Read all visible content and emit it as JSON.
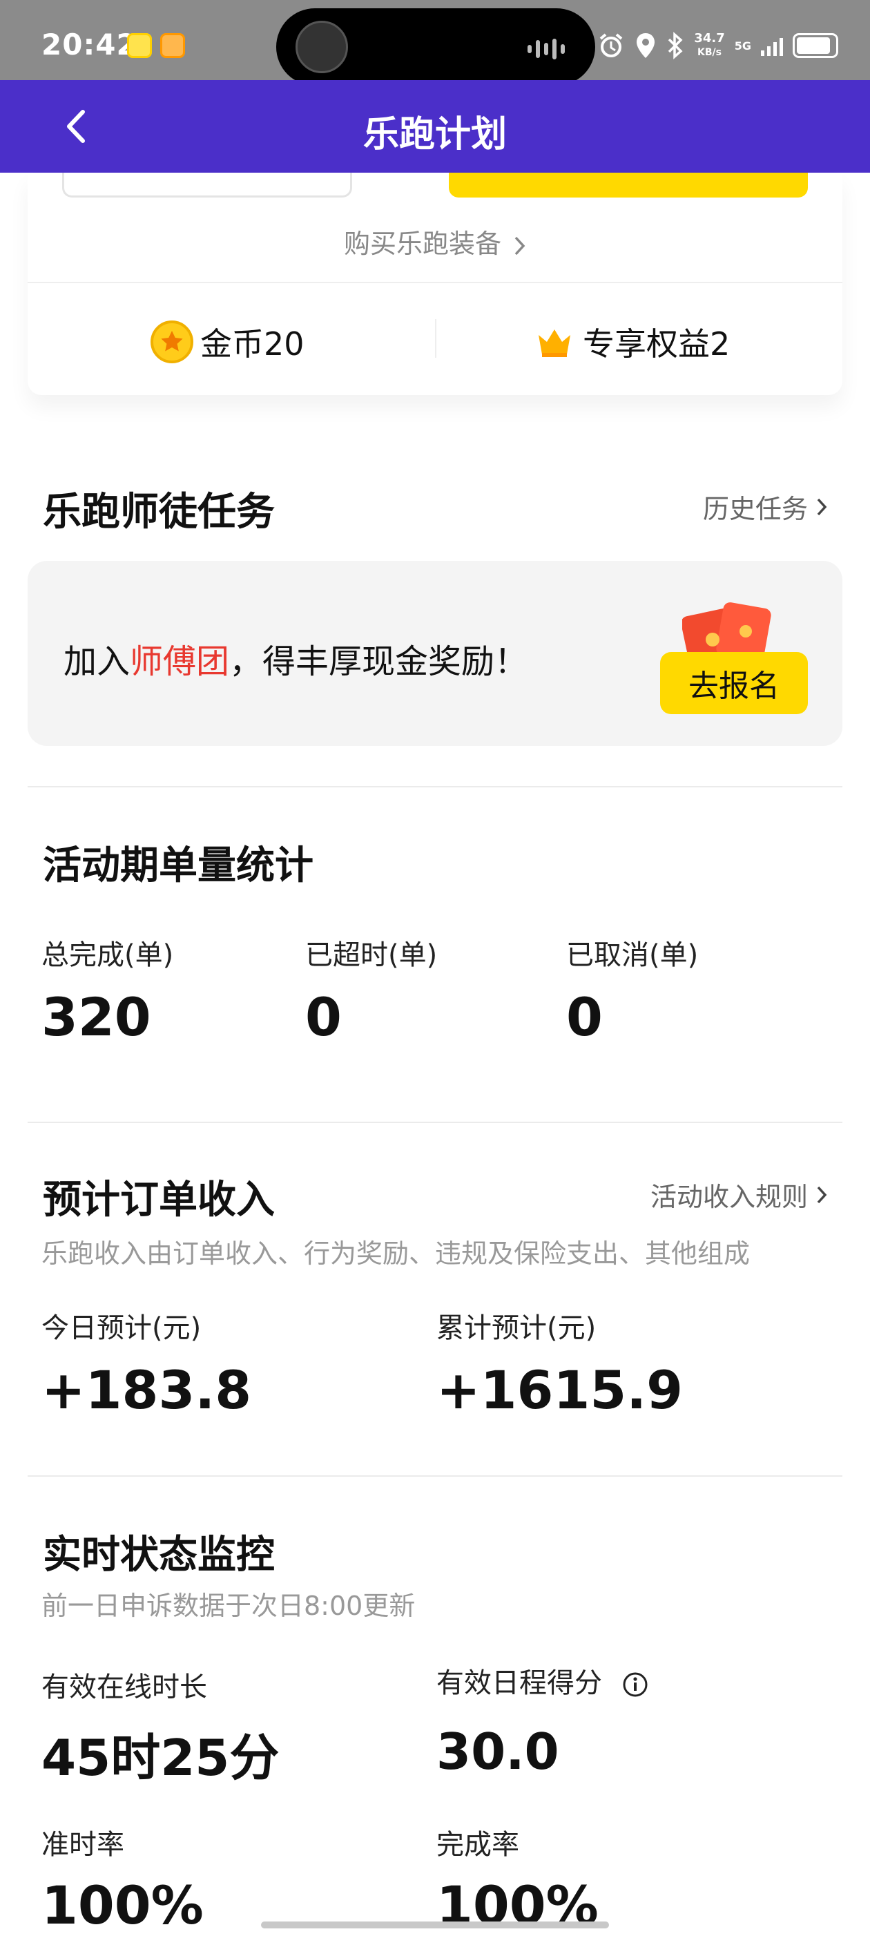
{
  "status_bar": {
    "time": "20:42",
    "net_speed": "34.7",
    "net_speed_unit": "KB/s",
    "network": "5G"
  },
  "nav": {
    "title": "乐跑计划"
  },
  "top_card": {
    "buy_link": "购买乐跑装备",
    "coins_label": "金币20",
    "rights_label": "专享权益2"
  },
  "mentor": {
    "title": "乐跑师徒任务",
    "history_link": "历史任务",
    "text_prefix": "加入",
    "text_highlight": "师傅团",
    "text_suffix": "，得丰厚现金奖励！",
    "signup_button": "去报名"
  },
  "order_stats": {
    "title": "活动期单量统计",
    "items": [
      {
        "label": "总完成(单)",
        "value": "320"
      },
      {
        "label": "已超时(单)",
        "value": "0"
      },
      {
        "label": "已取消(单)",
        "value": "0"
      }
    ]
  },
  "income": {
    "title": "预计订单收入",
    "rules_link": "活动收入规则",
    "description": "乐跑收入由订单收入、行为奖励、违规及保险支出、其他组成",
    "today_label": "今日预计(元)",
    "today_value": "+183.8",
    "total_label": "累计预计(元)",
    "total_value": "+1615.9"
  },
  "monitor": {
    "title": "实时状态监控",
    "description": "前一日申诉数据于次日8:00更新",
    "online_label": "有效在线时长",
    "online_value": "45时25分",
    "schedule_label": "有效日程得分",
    "schedule_value": "30.0",
    "ontime_label": "准时率",
    "ontime_value": "100%",
    "completion_label": "完成率",
    "completion_value": "100%"
  },
  "colors": {
    "nav_bg": "#4b2fc9",
    "accent_yellow": "#ffd900",
    "highlight_red": "#e8382f"
  }
}
